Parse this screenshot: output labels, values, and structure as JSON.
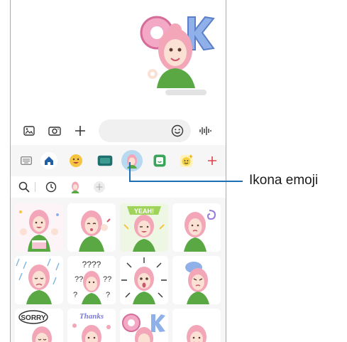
{
  "callout": {
    "label": "Ikona emoji"
  },
  "icons": {
    "gallery": "gallery-icon",
    "camera": "camera-icon",
    "add": "plus-icon",
    "emoji": "smiley-icon",
    "voice": "voice-icon",
    "keyboard": "keyboard-icon",
    "home": "home-icon",
    "search": "search-icon",
    "recent": "clock-icon",
    "add_sticker": "plus-circle-icon"
  },
  "colors": {
    "accent_blue": "#1f6fb5",
    "tab_active": "#b8d9f2",
    "add_red": "#e0404a",
    "hair_pink": "#f2a6b8",
    "shirt_green": "#5aa844"
  },
  "stickers": [
    {
      "name": "party-cake"
    },
    {
      "name": "kiss-wave"
    },
    {
      "name": "yeah-wink"
    },
    {
      "name": "swirl-dizzy"
    },
    {
      "name": "rain-sad"
    },
    {
      "name": "question-marks"
    },
    {
      "name": "shocked-burst"
    },
    {
      "name": "angry-bubble"
    },
    {
      "name": "sorry"
    },
    {
      "name": "thanks"
    },
    {
      "name": "ok"
    },
    {
      "name": "smile"
    }
  ]
}
